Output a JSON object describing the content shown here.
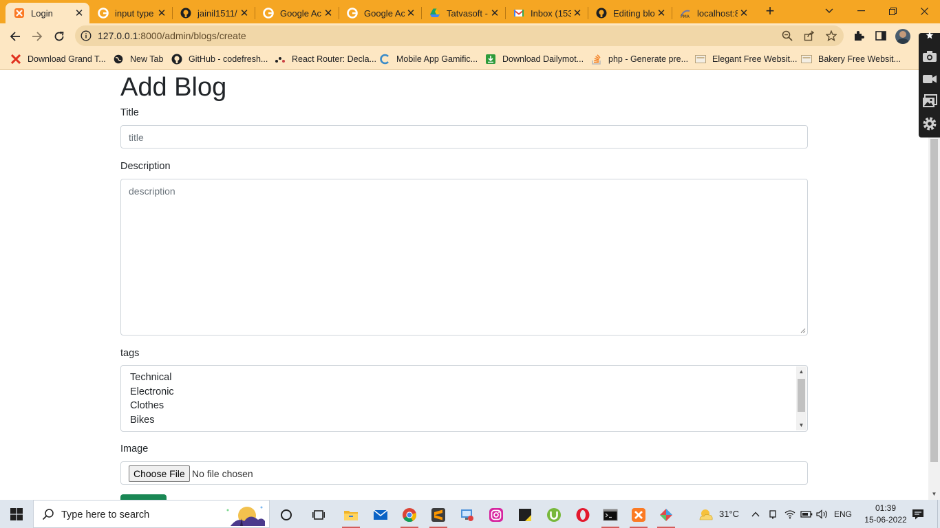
{
  "browser": {
    "tabs": [
      {
        "label": "Login",
        "icon": "xampp-icon",
        "active": true
      },
      {
        "label": "input type",
        "icon": "google-icon"
      },
      {
        "label": "jainil1511/",
        "icon": "github-icon"
      },
      {
        "label": "Google Ac",
        "icon": "google-icon"
      },
      {
        "label": "Google Ac",
        "icon": "google-icon"
      },
      {
        "label": "Tatvasoft -",
        "icon": "google-drive-icon"
      },
      {
        "label": "Inbox (153",
        "icon": "gmail-icon"
      },
      {
        "label": "Editing blo",
        "icon": "github-icon"
      },
      {
        "label": "localhost:8",
        "icon": "phpmyadmin-icon"
      }
    ],
    "url_host": "127.0.0.1",
    "url_path": ":8000/admin/blogs/create",
    "bookmarks": [
      {
        "label": "Download Grand T...",
        "icon": "x-icon"
      },
      {
        "label": "New Tab",
        "icon": "globe-icon"
      },
      {
        "label": "GitHub - codefresh...",
        "icon": "github-icon"
      },
      {
        "label": "React Router: Decla...",
        "icon": "react-router-icon"
      },
      {
        "label": "Mobile App Gamific...",
        "icon": "c-logo-icon"
      },
      {
        "label": "Download Dailymot...",
        "icon": "download-icon"
      },
      {
        "label": "php - Generate pre...",
        "icon": "stackoverflow-icon"
      },
      {
        "label": "Elegant Free Websit...",
        "icon": "page-icon"
      },
      {
        "label": "Bakery Free Websit...",
        "icon": "page-icon"
      }
    ]
  },
  "form": {
    "heading": "Add Blog",
    "title_label": "Title",
    "title_placeholder": "title",
    "description_label": "Description",
    "description_placeholder": "description",
    "tags_label": "tags",
    "tags_options": [
      "Technical",
      "Electronic",
      "Clothes",
      "Bikes"
    ],
    "image_label": "Image",
    "choose_file_label": "Choose File",
    "no_file_text": "No file chosen"
  },
  "taskbar": {
    "search_placeholder": "Type here to search",
    "temperature": "31°C",
    "language": "ENG",
    "time": "01:39",
    "date": "15-06-2022"
  },
  "colors": {
    "tabstrip": "#f5a623",
    "toolbar": "#fde7c3",
    "submit": "#198754"
  }
}
